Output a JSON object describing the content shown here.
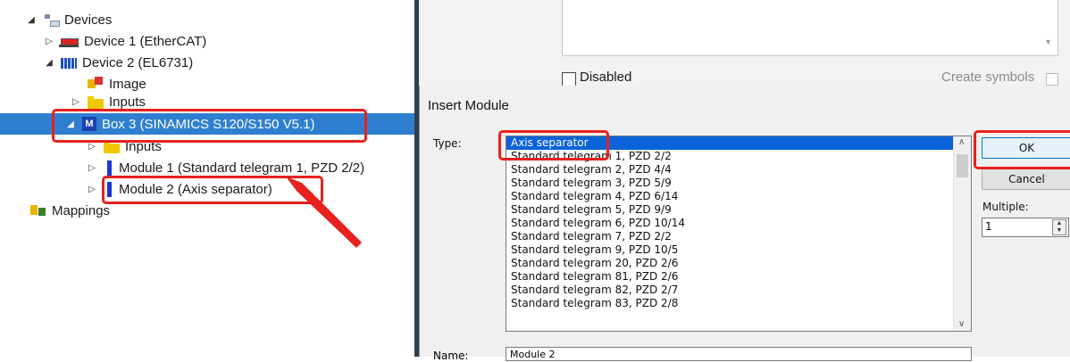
{
  "tree": {
    "devices_label": "Devices",
    "device1_label": "Device 1 (EtherCAT)",
    "device2_label": "Device 2 (EL6731)",
    "image_label": "Image",
    "inputs_label": "Inputs",
    "box3_label": "Box 3 (SINAMICS S120/S150 V5.1)",
    "box3_inputs_label": "Inputs",
    "module1_label": "Module 1 (Standard telegram 1, PZD 2/2)",
    "module2_label": "Module 2 (Axis separator)",
    "mappings_label": "Mappings",
    "box_icon_letter": "M"
  },
  "props": {
    "disabled_label": "Disabled",
    "create_symbols_label": "Create symbols"
  },
  "dialog": {
    "title": "Insert Module",
    "type_label": "Type:",
    "options": [
      "Axis separator",
      "Standard telegram 1, PZD 2/2",
      "Standard telegram 2, PZD 4/4",
      "Standard telegram 3, PZD 5/9",
      "Standard telegram 4, PZD 6/14",
      "Standard telegram 5, PZD 9/9",
      "Standard telegram 6, PZD 10/14",
      "Standard telegram 7, PZD 2/2",
      "Standard telegram 9, PZD 10/5",
      "Standard telegram 20, PZD 2/6",
      "Standard telegram 81, PZD 2/6",
      "Standard telegram 82, PZD 2/7",
      "Standard telegram 83, PZD 2/8"
    ],
    "ok_label": "OK",
    "cancel_label": "Cancel",
    "multiple_label": "Multiple:",
    "multiple_value": "1",
    "name_label": "Name:",
    "name_value": "Module 2"
  },
  "colors": {
    "selection": "#2f7fd0",
    "list_selection": "#0a63d8",
    "annotation": "#e8201e"
  }
}
